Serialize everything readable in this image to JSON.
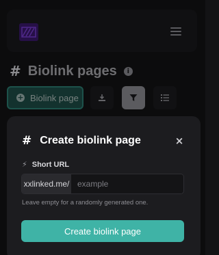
{
  "header": {
    "logo_icon": "logo-icon",
    "menu_icon": "hamburger-menu-icon"
  },
  "page": {
    "title_hash": "#",
    "title": "Biolink pages",
    "info_icon": "i"
  },
  "toolbar": {
    "create_label": "Biolink page",
    "create_icon": "+",
    "download_icon": "download-icon",
    "filter_icon": "filter-icon",
    "list_icon": "list-icon"
  },
  "modal": {
    "title_hash": "#",
    "title": "Create biolink page",
    "close_icon": "×",
    "field_icon": "⚡",
    "field_label": "Short URL",
    "url_prefix": "xxlinked.me/",
    "url_placeholder": "example",
    "url_value": "",
    "help_text": "Leave empty for a randomly generated one.",
    "submit_label": "Create biolink page"
  },
  "colors": {
    "accent": "#3fb3a6",
    "background": "#131315",
    "card": "#1c1c1f"
  }
}
